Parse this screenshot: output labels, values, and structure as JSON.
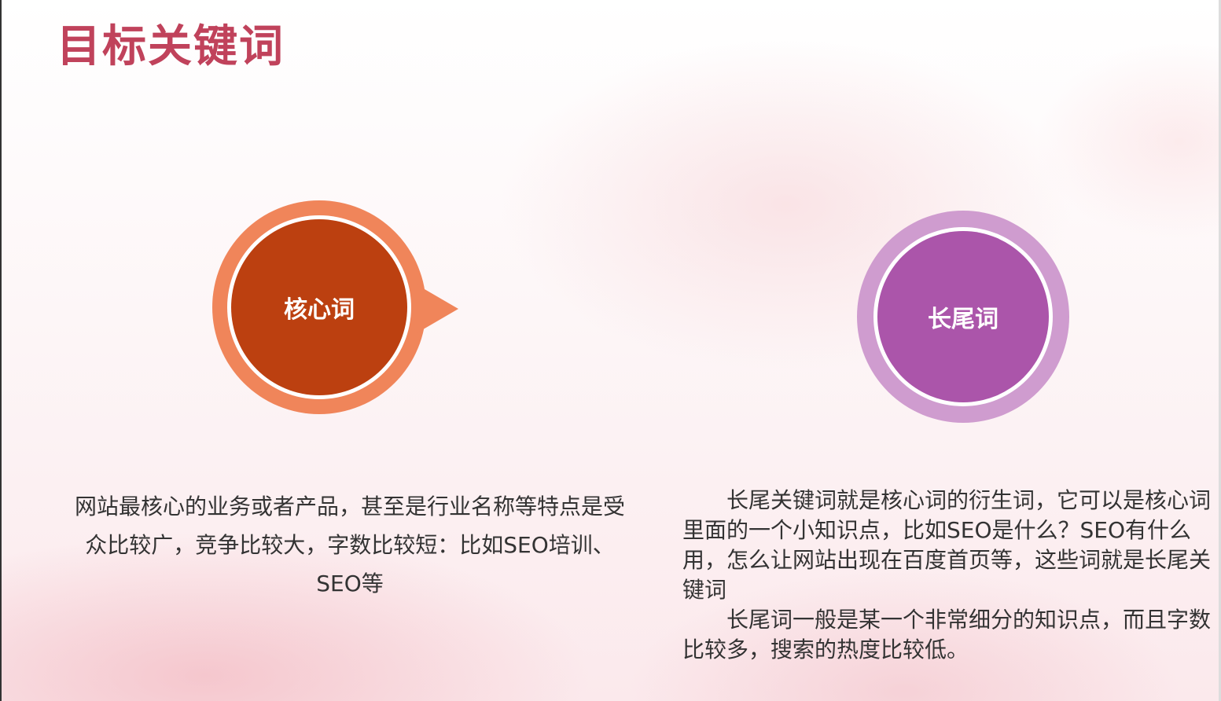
{
  "slide": {
    "title": "目标关键词",
    "core": {
      "label": "核心词",
      "description": "网站最核心的业务或者产品，甚至是行业名称等特点是受众比较广，竞争比较大，字数比较短：比如SEO培训、SEO等"
    },
    "longtail": {
      "label": "长尾词",
      "paragraph1": "　　长尾关键词就是核心词的衍生词，它可以是核心词里面的一个小知识点，比如SEO是什么？SEO有什么用，怎么让网站出现在百度首页等，这些词就是长尾关键词",
      "paragraph2": "　　长尾词一般是某一个非常细分的知识点，而且字数比较多，搜索的热度比较低。"
    }
  },
  "colors": {
    "title": "#c0425b",
    "core_outer": "#f0855a",
    "core_inner": "#bc4010",
    "longtail_outer": "#cf9ccf",
    "longtail_inner": "#ab55aa"
  }
}
